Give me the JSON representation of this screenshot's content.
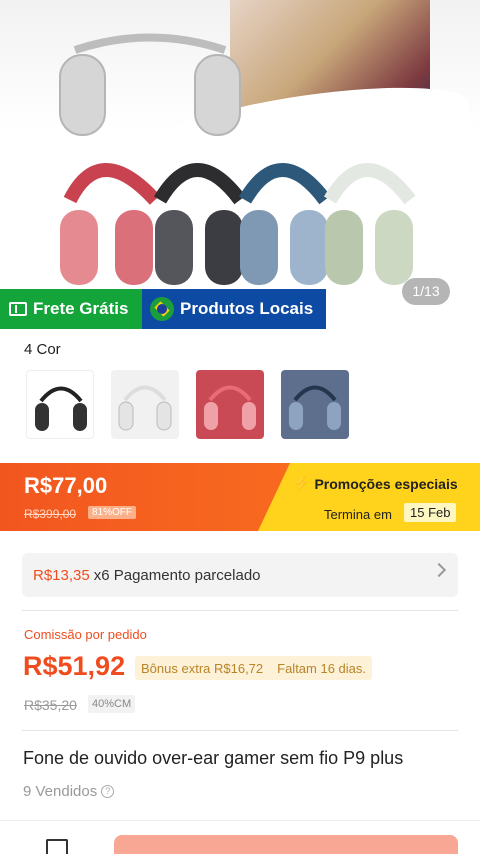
{
  "gallery": {
    "counter": "1/13",
    "badges": {
      "free_shipping": "Frete Grátis",
      "local_products": "Produtos Locais"
    }
  },
  "colors": {
    "label": "4 Cor",
    "options": [
      "black",
      "white",
      "red",
      "blue"
    ]
  },
  "price_banner": {
    "price": "R$77,00",
    "old_price": "R$399,00",
    "discount": "81%OFF",
    "promo_title": "Promoções especiais",
    "ends_label": "Termina em",
    "ends_date": "15 Feb"
  },
  "installments": {
    "price": "R$13,35",
    "text": "x6 Pagamento parcelado"
  },
  "commission": {
    "label": "Comissão por pedido",
    "amount": "R$51,92",
    "bonus": "Bônus extra R$16,72",
    "days_left": "Faltam 16 dias.",
    "old_amount": "R$35,20",
    "rate": "40%CM"
  },
  "product": {
    "title": "Fone de ouvido over-ear gamer sem fio P9 plus",
    "sold": "9 Vendidos"
  },
  "theme": {
    "accent": "#ef4d1f",
    "free_shipping_green": "#14a53a",
    "local_blue": "#0c4aa3",
    "promo_yellow": "#ffd21c"
  }
}
